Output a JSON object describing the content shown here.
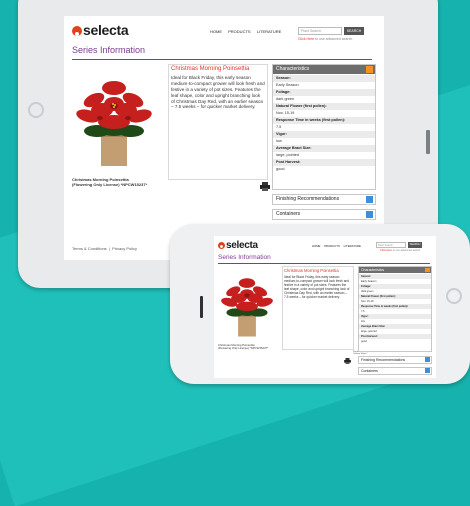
{
  "brand": "selecta",
  "nav": [
    "HOME",
    "PRODUCTS",
    "LITERATURE"
  ],
  "search": {
    "placeholder": "Plant Search",
    "button": "SEARCH"
  },
  "advanced": {
    "link": "Click Here",
    "text": " to use advanced search"
  },
  "section_title": "Series Information",
  "product": {
    "name": "Christmas Morning Poinsettia",
    "description": "Ideal for Black Friday, this early season medium-to-compact grower will look fresh and festive in a variety of pot sizes. Features the leaf shape, color and upright branching look of Christmas Day Red, with an earlier season – 7.5 weeks – for quicker market delivery.",
    "caption_line1": "Christmas Morning Poinsettia",
    "caption_line2": "(Flowering Only License) *NPCW15237*"
  },
  "print": {
    "line1": "Printer Friendly",
    "line2": "Culture Sheet"
  },
  "characteristics": {
    "title": "Characteristics",
    "rows": [
      {
        "label": "Season:",
        "value": "Early Season"
      },
      {
        "label": "Foliage:",
        "value": "dark green"
      },
      {
        "label": "Natural Flower (first pollen):",
        "value": "Nov. 15-19"
      },
      {
        "label": "Response Time in weeks (first pollen):",
        "value": "7.5"
      },
      {
        "label": "Vigor:",
        "value": "low"
      },
      {
        "label": "Average Bract Size:",
        "value": "large, pointed"
      },
      {
        "label": "Post Harvest:",
        "value": "good"
      }
    ]
  },
  "accordions": [
    "Finishing Recommendations",
    "Containers"
  ],
  "footer": "Terms & Conditions  |  Privacy Policy",
  "colors": {
    "accent_red": "#e3322a",
    "title_purple": "#7a3e8e",
    "minus_orange": "#f39221",
    "plus_blue": "#3f8fd8",
    "background": "#16b2ad"
  }
}
